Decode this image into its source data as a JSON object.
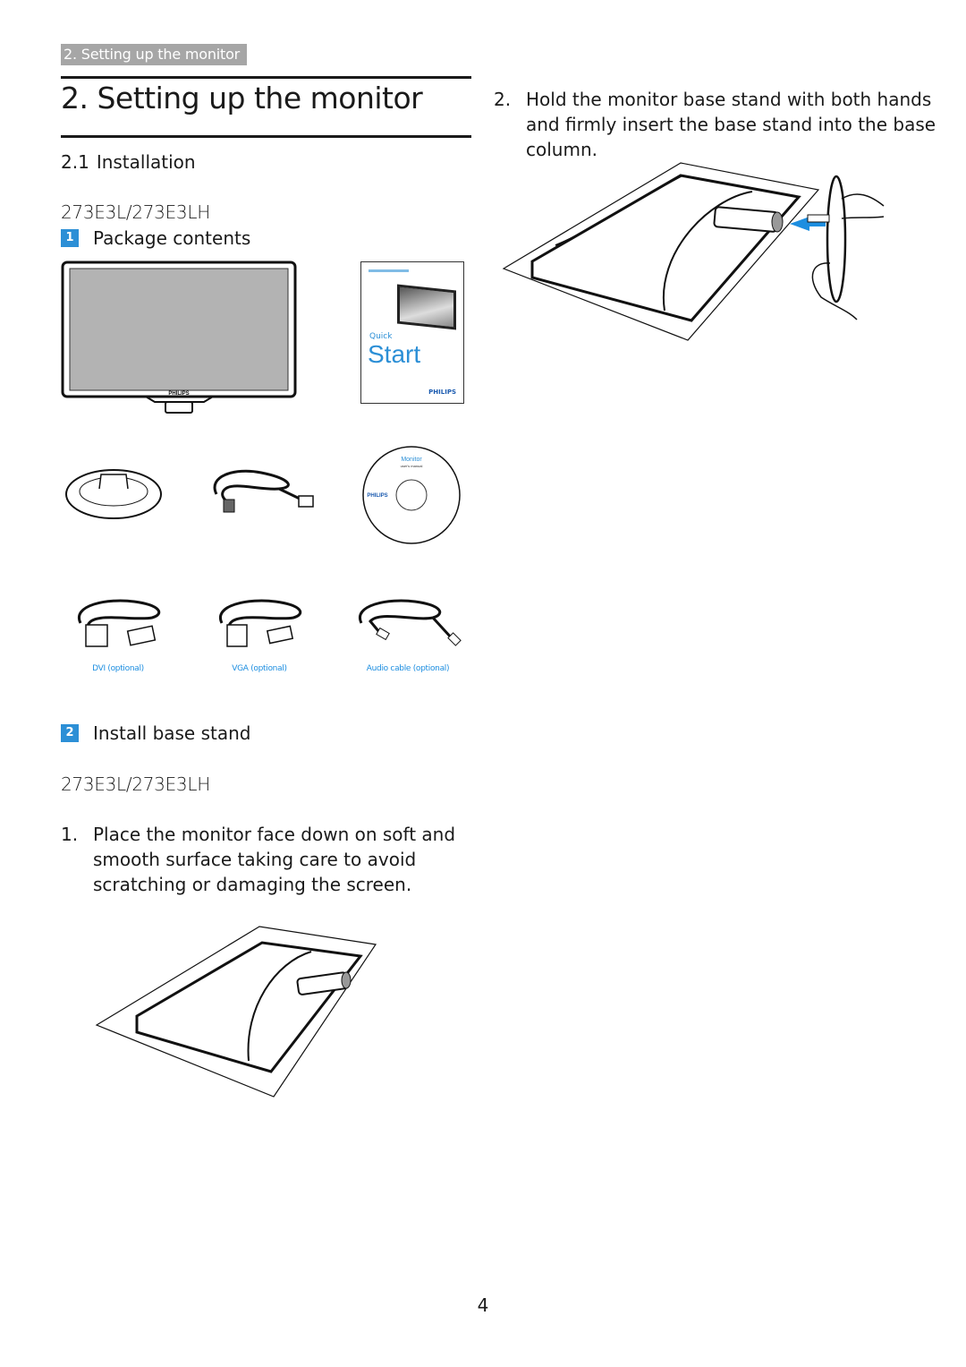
{
  "header": {
    "section_tab": "2. Setting up the monitor",
    "title": "2. Setting up the monitor"
  },
  "installation": {
    "number": "2.1",
    "label": "Installation"
  },
  "package": {
    "model": "273E3L/273E3LH",
    "step_number": "1",
    "title": "Package contents",
    "items": {
      "monitor_brand": "PHILIPS",
      "quick_start": {
        "line1": "Quick",
        "line2": "Start",
        "brand": "PHILIPS"
      },
      "cd": {
        "title": "Monitor",
        "subtitle": "user's manual",
        "brand": "PHILIPS"
      },
      "captions": [
        "DVI (optional)",
        "VGA (optional)",
        "Audio cable (optional)"
      ]
    }
  },
  "install_stand": {
    "step_number": "2",
    "title": "Install base stand",
    "model": "273E3L/273E3LH",
    "steps": [
      {
        "n": "1.",
        "text": "Place the monitor face down on soft and smooth surface taking care to avoid scratching or damaging the screen."
      },
      {
        "n": "2.",
        "text": "Hold the monitor base stand with both hands and firmly insert the base stand into the base column."
      }
    ]
  },
  "colors": {
    "accent": "#2c8fd6",
    "tab_bg": "#a6a6a6",
    "screen": "#b3b3b3"
  },
  "page_number": "4"
}
